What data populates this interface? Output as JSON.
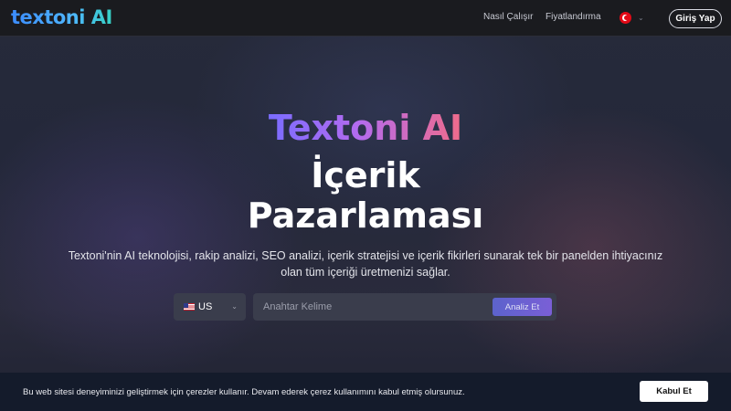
{
  "nav": {
    "logo": "textoni AI",
    "links": [
      {
        "label": "Nasıl Çalışır"
      },
      {
        "label": "Fiyatlandırma"
      }
    ],
    "language_icon": "turkey-flag-icon",
    "login_label": "Giriş Yap"
  },
  "hero": {
    "title_brand": "Textoni AI",
    "title_line2": "İçerik",
    "title_line3": "Pazarlaması",
    "description": "Textoni'nin AI teknolojisi, rakip analizi, SEO analizi, içerik stratejisi ve içerik fikirleri sunarak tek bir panelden ihtiyacınız olan tüm içeriği üretmenizi sağlar."
  },
  "search": {
    "country_label": "US",
    "country_icon": "us-flag-icon",
    "keyword_placeholder": "Anahtar Kelime",
    "keyword_value": "",
    "analyze_label": "Analiz Et"
  },
  "cookie": {
    "text": "Bu web sitesi deneyiminizi geliştirmek için çerezler kullanır. Devam ederek çerez kullanımını kabul etmiş olursunuz.",
    "accept_label": "Kabul Et"
  },
  "colors": {
    "nav_bg": "#1a1b1f",
    "brand_blue": "#3b8cff",
    "accent_purple": "#7a5fd6",
    "cookie_bg": "#141b2b"
  }
}
